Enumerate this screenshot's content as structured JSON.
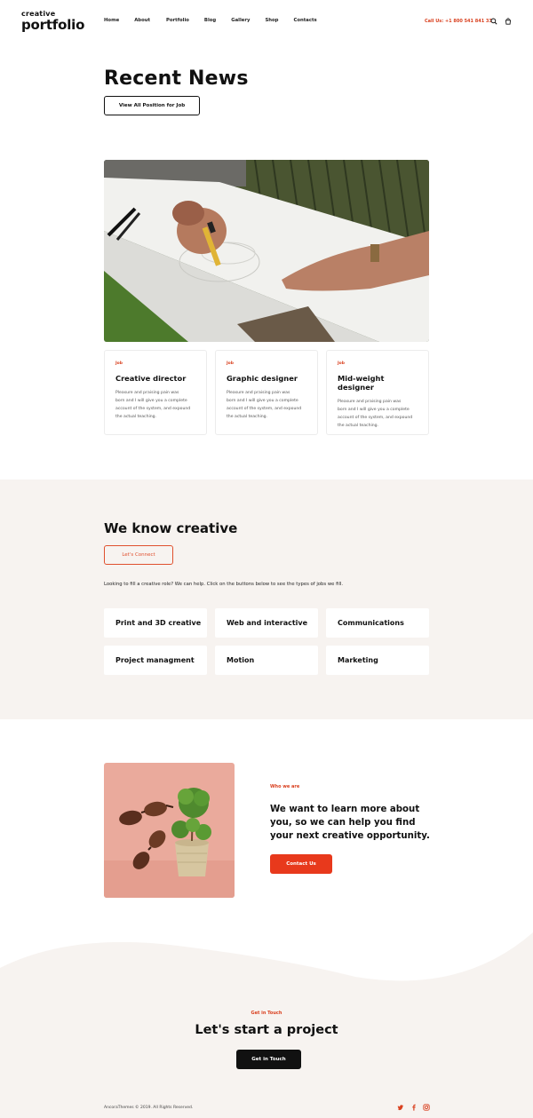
{
  "logo": {
    "line1": "creative",
    "line2": "portfolio"
  },
  "nav": [
    "Home",
    "About",
    "Portfolio",
    "Blog",
    "Gallery",
    "Shop",
    "Contacts"
  ],
  "header": {
    "call": "Call Us: +1 800 541 841 33"
  },
  "news": {
    "title": "Recent News",
    "button": "View All Position for Job",
    "cards": [
      {
        "tag": "Job",
        "title": "Creative director",
        "desc": [
          "Pleasure and praising pain was",
          "born and I will give you a complete",
          "account of the system, and expound",
          "the actual teaching."
        ]
      },
      {
        "tag": "Job",
        "title": "Graphic designer",
        "desc": [
          "Pleasure and praising pain was",
          "born and I will give you a complete",
          "account of the system, and expound",
          "the actual teaching."
        ]
      },
      {
        "tag": "Job",
        "title": "Mid-weight designer",
        "desc": [
          "Pleasure and praising pain was",
          "born and I will give you a complete",
          "account of the system, and expound",
          "the actual teaching."
        ]
      }
    ]
  },
  "creative": {
    "title": "We know creative",
    "button": "Let's Connect",
    "text": "Looking to fill a creative role?  We can help. Click on the buttons below to see the types of jobs we fill.",
    "jobs": [
      "Print and 3D creative",
      "Web and interactive",
      "Communications",
      "Project managment",
      "Motion",
      "Marketing"
    ]
  },
  "who": {
    "tag": "Who we are",
    "text": "We want to learn more about you, so we can help you find your next creative opportunity.",
    "button": "Contact Us"
  },
  "footer": {
    "tag": "Get in Touch",
    "title": "Let's start a project",
    "button": "Get in Touch",
    "copyright": "AncoraThemes © 2019. All Rights Reserved."
  },
  "colors": {
    "accent": "#e8391c",
    "section_bg": "#f7f3f0"
  },
  "icons": [
    "search-icon",
    "cart-icon",
    "twitter-icon",
    "facebook-icon",
    "instagram-icon"
  ]
}
